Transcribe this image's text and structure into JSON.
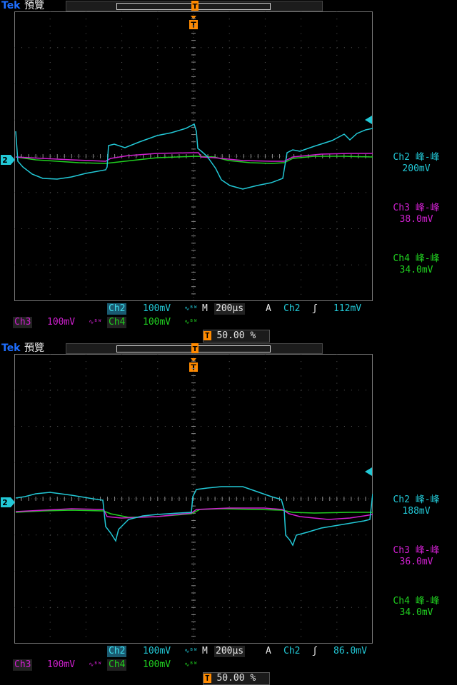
{
  "screens": [
    {
      "brand": "Tek",
      "mode": "預覽",
      "readouts": {
        "ch2": {
          "label": "Ch2 峰-峰",
          "value": "200mV"
        },
        "ch3": {
          "label": "Ch3 峰-峰",
          "value": "38.0mV"
        },
        "ch4": {
          "label": "Ch4 峰-峰",
          "value": "34.0mV"
        }
      },
      "status": {
        "ch2_label": "Ch2",
        "ch2_scale": "100mV",
        "timebase_prefix": "M",
        "timebase": "200µs",
        "acq": "A",
        "trig_source": "Ch2",
        "trig_level": "112mV",
        "ch3_label": "Ch3",
        "ch3_scale": "100mV",
        "ch4_label": "Ch4",
        "ch4_scale": "100mV",
        "trigger_pos": "50.00 %"
      },
      "trigger_marker": "T",
      "ch_marker": "2"
    },
    {
      "brand": "Tek",
      "mode": "預覽",
      "readouts": {
        "ch2": {
          "label": "Ch2 峰-峰",
          "value": "188mV"
        },
        "ch3": {
          "label": "Ch3 峰-峰",
          "value": "36.0mV"
        },
        "ch4": {
          "label": "Ch4 峰-峰",
          "value": "34.0mV"
        }
      },
      "status": {
        "ch2_label": "Ch2",
        "ch2_scale": "100mV",
        "timebase_prefix": "M",
        "timebase": "200µs",
        "acq": "A",
        "trig_source": "Ch2",
        "trig_level": "86.0mV",
        "ch3_label": "Ch3",
        "ch3_scale": "100mV",
        "ch4_label": "Ch4",
        "ch4_scale": "100mV",
        "trigger_pos": "50.00 %"
      },
      "trigger_marker": "T",
      "ch_marker": "2"
    }
  ],
  "colors": {
    "ch2": "#22c8d6",
    "ch3": "#d020d0",
    "ch4": "#20d020",
    "grid": "#5a5a5a",
    "trigger": "#ff8a00"
  }
}
